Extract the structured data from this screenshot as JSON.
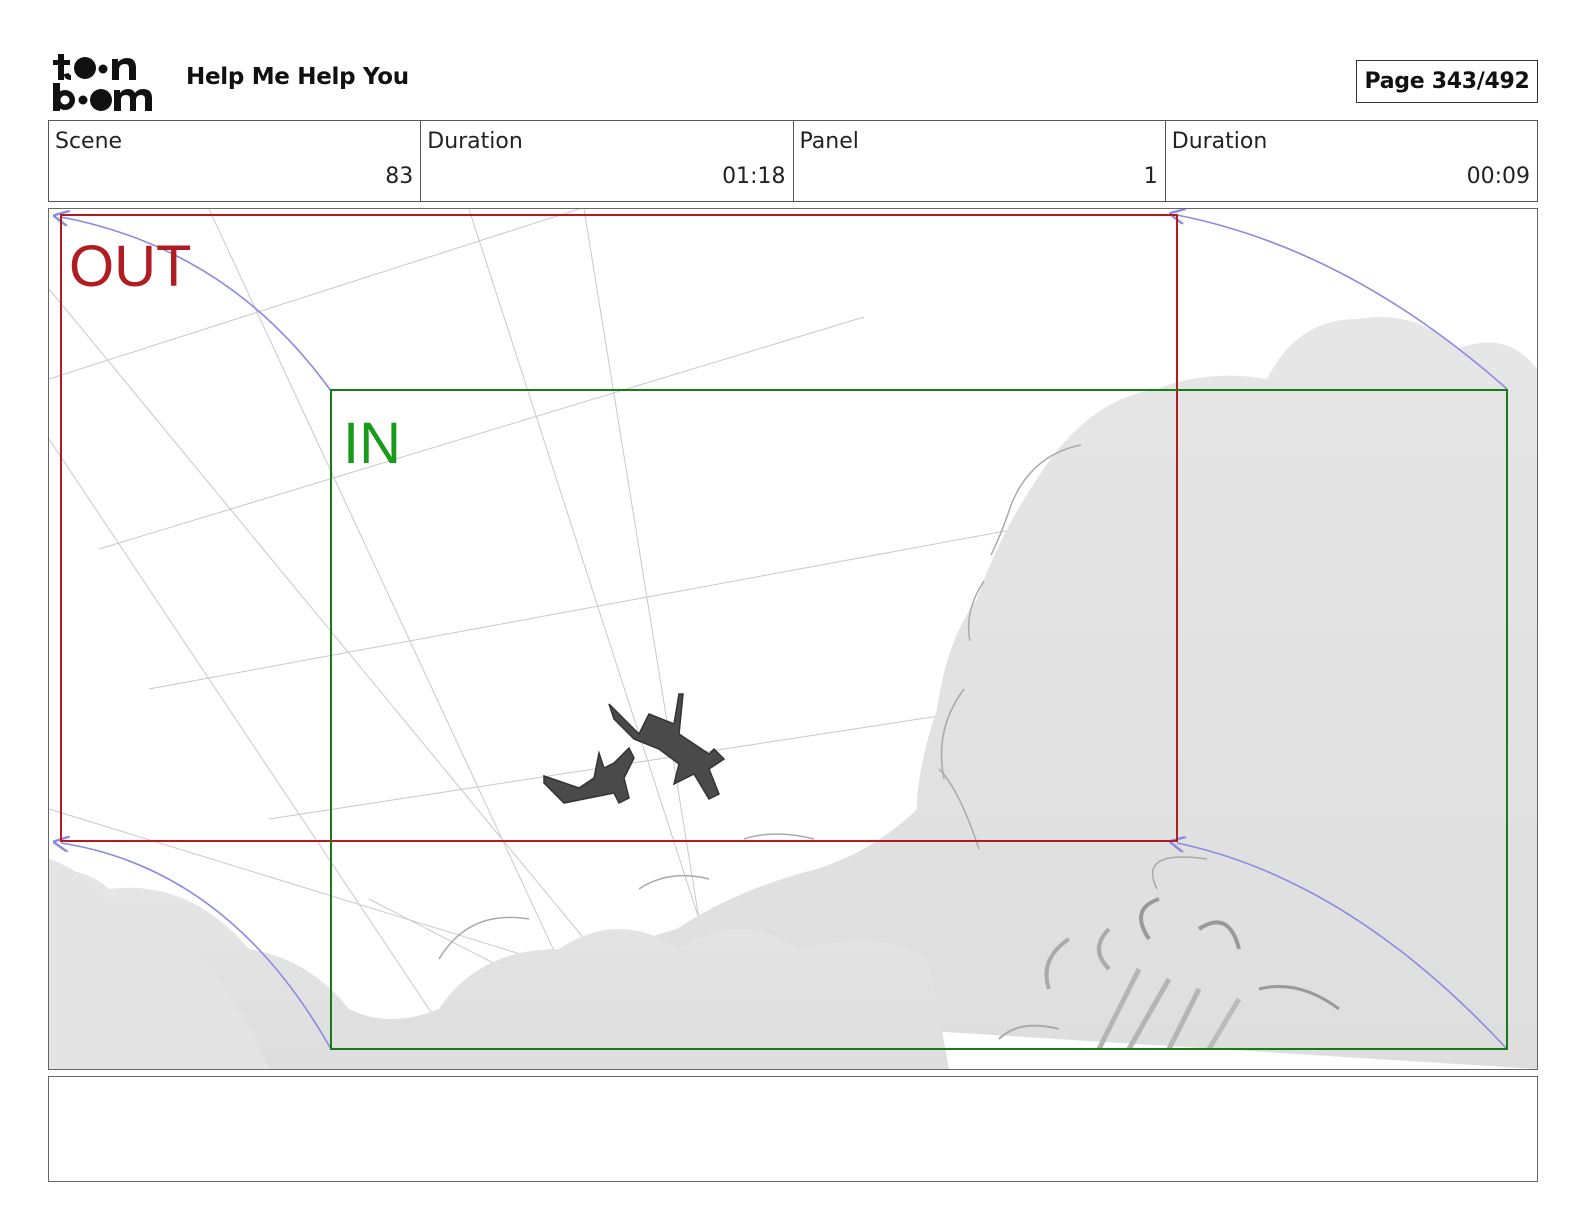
{
  "header": {
    "logo_top": "toon",
    "logo_bottom": "boom",
    "project_title": "Help Me Help You",
    "page_label": "Page 343/492"
  },
  "info": {
    "scene_label": "Scene",
    "scene_value": "83",
    "scene_duration_label": "Duration",
    "scene_duration_value": "01:18",
    "panel_label": "Panel",
    "panel_value": "1",
    "panel_duration_label": "Duration",
    "panel_duration_value": "00:09"
  },
  "panel": {
    "out_label": "OUT",
    "in_label": "IN",
    "out_color": "#b01c22",
    "in_color": "#1a9a1a",
    "arrow_color": "#8a8ae0"
  },
  "notes": {
    "text": ""
  }
}
